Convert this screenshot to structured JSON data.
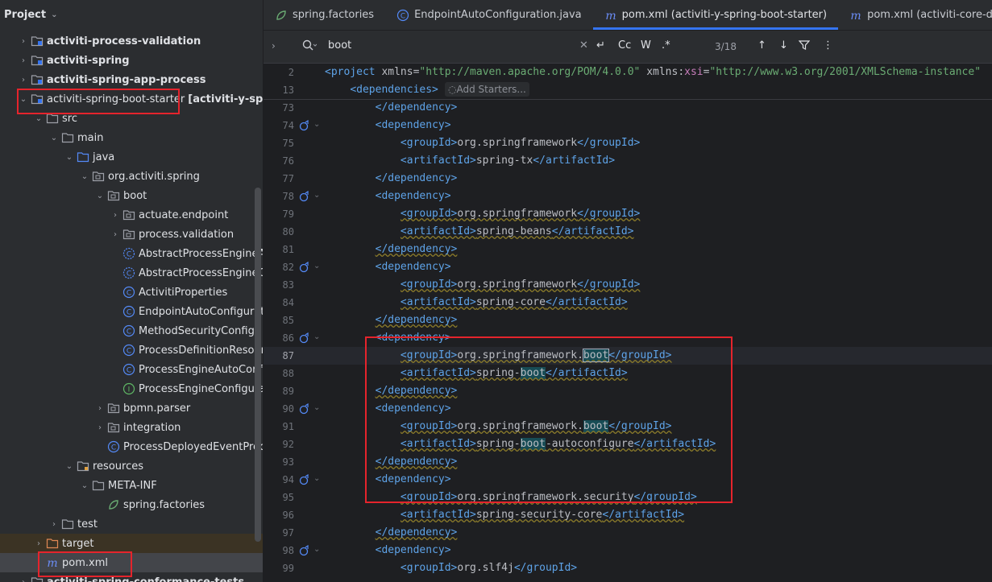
{
  "project": {
    "title": "Project",
    "items": [
      {
        "label": "activiti-process-validation",
        "bold": true,
        "indent": 0,
        "arrow": "›",
        "icon": "module"
      },
      {
        "label": "activiti-spring",
        "bold": true,
        "indent": 0,
        "arrow": "›",
        "icon": "module"
      },
      {
        "label": "activiti-spring-app-process",
        "bold": true,
        "indent": 0,
        "arrow": "›",
        "icon": "module"
      },
      {
        "label": "activiti-spring-boot-starter",
        "bold": false,
        "indent": 0,
        "arrow": "⌄",
        "icon": "module",
        "suffix": "[activiti-y-spring-"
      },
      {
        "label": "src",
        "indent": 1,
        "arrow": "⌄",
        "icon": "folder"
      },
      {
        "label": "main",
        "indent": 2,
        "arrow": "⌄",
        "icon": "folder"
      },
      {
        "label": "java",
        "indent": 3,
        "arrow": "⌄",
        "icon": "folder-src"
      },
      {
        "label": "org.activiti.spring",
        "indent": 4,
        "arrow": "⌄",
        "icon": "package"
      },
      {
        "label": "boot",
        "indent": 5,
        "arrow": "⌄",
        "icon": "package"
      },
      {
        "label": "actuate.endpoint",
        "indent": 6,
        "arrow": "›",
        "icon": "package"
      },
      {
        "label": "process.validation",
        "indent": 6,
        "arrow": "›",
        "icon": "package"
      },
      {
        "label": "AbstractProcessEngineAuto",
        "indent": 6,
        "arrow": "",
        "icon": "class-abstract"
      },
      {
        "label": "AbstractProcessEngineCo",
        "indent": 6,
        "arrow": "",
        "icon": "class-abstract"
      },
      {
        "label": "ActivitiProperties",
        "indent": 6,
        "arrow": "",
        "icon": "class"
      },
      {
        "label": "EndpointAutoConfiguratio",
        "indent": 6,
        "arrow": "",
        "icon": "class"
      },
      {
        "label": "MethodSecurityConfig",
        "indent": 6,
        "arrow": "",
        "icon": "class"
      },
      {
        "label": "ProcessDefinitionResource",
        "indent": 6,
        "arrow": "",
        "icon": "class"
      },
      {
        "label": "ProcessEngineAutoConfig",
        "indent": 6,
        "arrow": "",
        "icon": "class"
      },
      {
        "label": "ProcessEngineConfigurati",
        "indent": 6,
        "arrow": "",
        "icon": "interface"
      },
      {
        "label": "bpmn.parser",
        "indent": 5,
        "arrow": "›",
        "icon": "package"
      },
      {
        "label": "integration",
        "indent": 5,
        "arrow": "›",
        "icon": "package"
      },
      {
        "label": "ProcessDeployedEventProdu",
        "indent": 5,
        "arrow": "",
        "icon": "class"
      },
      {
        "label": "resources",
        "indent": 3,
        "arrow": "⌄",
        "icon": "folder-res"
      },
      {
        "label": "META-INF",
        "indent": 4,
        "arrow": "⌄",
        "icon": "folder"
      },
      {
        "label": "spring.factories",
        "indent": 5,
        "arrow": "",
        "icon": "spring"
      },
      {
        "label": "test",
        "indent": 2,
        "arrow": "›",
        "icon": "folder"
      },
      {
        "label": "target",
        "indent": 1,
        "arrow": "›",
        "icon": "folder-target"
      },
      {
        "label": "pom.xml",
        "indent": 1,
        "arrow": "",
        "icon": "maven"
      },
      {
        "label": "activiti-spring-conformance-tests",
        "bold": true,
        "indent": 0,
        "arrow": "›",
        "icon": "module"
      }
    ]
  },
  "tabs": [
    {
      "label": "spring.factories",
      "icon": "spring"
    },
    {
      "label": "EndpointAutoConfiguration.java",
      "icon": "class"
    },
    {
      "label": "pom.xml (activiti-y-spring-boot-starter)",
      "icon": "maven",
      "active": true
    },
    {
      "label": "pom.xml (activiti-core-depende",
      "icon": "maven"
    }
  ],
  "search": {
    "query": "boot",
    "count": "3/18",
    "case_label": "Cc",
    "word_label": "W",
    "regex_label": ".*"
  },
  "editor": {
    "sticky": [
      {
        "num": "2",
        "parts": [
          [
            "tg",
            "<project "
          ],
          [
            "at",
            "xmlns"
          ],
          [
            "tx",
            "="
          ],
          [
            "av",
            "\"http://maven.apache.org/POM/4.0.0\""
          ],
          [
            "tx",
            " "
          ],
          [
            "at",
            "xmlns"
          ],
          [
            "tx",
            ":"
          ],
          [
            "ns",
            "xsi"
          ],
          [
            "tx",
            "="
          ],
          [
            "av",
            "\"http://www.w3.org/2001/XMLSchema-instance\""
          ]
        ]
      },
      {
        "num": "13",
        "parts": [
          [
            "tx",
            "    "
          ],
          [
            "tg",
            "<dependencies>"
          ]
        ]
      }
    ],
    "add_starters": "Add Starters...",
    "lines": [
      {
        "num": "73",
        "indent": "        ",
        "parts": [
          [
            "tg",
            "</dependency>"
          ]
        ]
      },
      {
        "num": "74",
        "indent": "        ",
        "gicon": true,
        "parts": [
          [
            "tg",
            "<dependency>"
          ]
        ]
      },
      {
        "num": "75",
        "indent": "            ",
        "parts": [
          [
            "tg",
            "<groupId>"
          ],
          [
            "tx",
            "org.springframework"
          ],
          [
            "tg",
            "</groupId>"
          ]
        ]
      },
      {
        "num": "76",
        "indent": "            ",
        "parts": [
          [
            "tg",
            "<artifactId>"
          ],
          [
            "tx",
            "spring-tx"
          ],
          [
            "tg",
            "</artifactId>"
          ]
        ]
      },
      {
        "num": "77",
        "indent": "        ",
        "parts": [
          [
            "tg",
            "</dependency>"
          ]
        ]
      },
      {
        "num": "78",
        "indent": "        ",
        "gicon": true,
        "parts": [
          [
            "tg",
            "<dependency>"
          ]
        ]
      },
      {
        "num": "79",
        "indent": "            ",
        "wavy": true,
        "parts": [
          [
            "tg",
            "<groupId>"
          ],
          [
            "tx",
            "org.springframework"
          ],
          [
            "tg",
            "</groupId>"
          ]
        ]
      },
      {
        "num": "80",
        "indent": "            ",
        "wavy": true,
        "parts": [
          [
            "tg",
            "<artifactId>"
          ],
          [
            "tx",
            "spring-beans"
          ],
          [
            "tg",
            "</artifactId>"
          ]
        ]
      },
      {
        "num": "81",
        "indent": "        ",
        "wavy": true,
        "parts": [
          [
            "tg",
            "</dependency>"
          ]
        ]
      },
      {
        "num": "82",
        "indent": "        ",
        "gicon": true,
        "parts": [
          [
            "tg",
            "<dependency>"
          ]
        ]
      },
      {
        "num": "83",
        "indent": "            ",
        "wavy": true,
        "parts": [
          [
            "tg",
            "<groupId>"
          ],
          [
            "tx",
            "org.springframework"
          ],
          [
            "tg",
            "</groupId>"
          ]
        ]
      },
      {
        "num": "84",
        "indent": "            ",
        "wavy": true,
        "parts": [
          [
            "tg",
            "<artifactId>"
          ],
          [
            "tx",
            "spring-core"
          ],
          [
            "tg",
            "</artifactId>"
          ]
        ]
      },
      {
        "num": "85",
        "indent": "        ",
        "wavy": true,
        "parts": [
          [
            "tg",
            "</dependency>"
          ]
        ]
      },
      {
        "num": "86",
        "indent": "        ",
        "gicon": true,
        "parts": [
          [
            "tg",
            "<dependency>"
          ]
        ]
      },
      {
        "num": "87",
        "indent": "            ",
        "current": true,
        "wavy": true,
        "parts": [
          [
            "tg",
            "<groupId>"
          ],
          [
            "tx",
            "org.springframework."
          ],
          [
            "hitsel",
            "boot"
          ],
          [
            "tg",
            "</groupId>"
          ]
        ]
      },
      {
        "num": "88",
        "indent": "            ",
        "wavy": true,
        "parts": [
          [
            "tg",
            "<artifactId>"
          ],
          [
            "tx",
            "spring-"
          ],
          [
            "hit",
            "boot"
          ],
          [
            "tg",
            "</artifactId>"
          ]
        ]
      },
      {
        "num": "89",
        "indent": "        ",
        "wavy": true,
        "parts": [
          [
            "tg",
            "</dependency>"
          ]
        ]
      },
      {
        "num": "90",
        "indent": "        ",
        "gicon": true,
        "parts": [
          [
            "tg",
            "<dependency>"
          ]
        ]
      },
      {
        "num": "91",
        "indent": "            ",
        "wavy": true,
        "parts": [
          [
            "tg",
            "<groupId>"
          ],
          [
            "tx",
            "org.springframework."
          ],
          [
            "hit",
            "boot"
          ],
          [
            "tg",
            "</groupId>"
          ]
        ]
      },
      {
        "num": "92",
        "indent": "            ",
        "wavy": true,
        "parts": [
          [
            "tg",
            "<artifactId>"
          ],
          [
            "tx",
            "spring-"
          ],
          [
            "hit",
            "boot"
          ],
          [
            "tx",
            "-autoconfigure"
          ],
          [
            "tg",
            "</artifactId>"
          ]
        ]
      },
      {
        "num": "93",
        "indent": "        ",
        "wavy": true,
        "parts": [
          [
            "tg",
            "</dependency>"
          ]
        ]
      },
      {
        "num": "94",
        "indent": "        ",
        "gicon": true,
        "parts": [
          [
            "tg",
            "<dependency>"
          ]
        ]
      },
      {
        "num": "95",
        "indent": "            ",
        "wavy": true,
        "parts": [
          [
            "tg",
            "<groupId>"
          ],
          [
            "tx",
            "org.springframework.security"
          ],
          [
            "tg",
            "</groupId>"
          ]
        ]
      },
      {
        "num": "96",
        "indent": "            ",
        "wavy": true,
        "parts": [
          [
            "tg",
            "<artifactId>"
          ],
          [
            "tx",
            "spring-security-core"
          ],
          [
            "tg",
            "</artifactId>"
          ]
        ]
      },
      {
        "num": "97",
        "indent": "        ",
        "wavy": true,
        "parts": [
          [
            "tg",
            "</dependency>"
          ]
        ]
      },
      {
        "num": "98",
        "indent": "        ",
        "gicon": true,
        "parts": [
          [
            "tg",
            "<dependency>"
          ]
        ]
      },
      {
        "num": "99",
        "indent": "            ",
        "parts": [
          [
            "tg",
            "<groupId>"
          ],
          [
            "tx",
            "org.slf4j"
          ],
          [
            "tg",
            "</groupId>"
          ]
        ]
      }
    ]
  },
  "colors": {
    "highlight": "#e5242c",
    "accent": "#3574f0"
  }
}
